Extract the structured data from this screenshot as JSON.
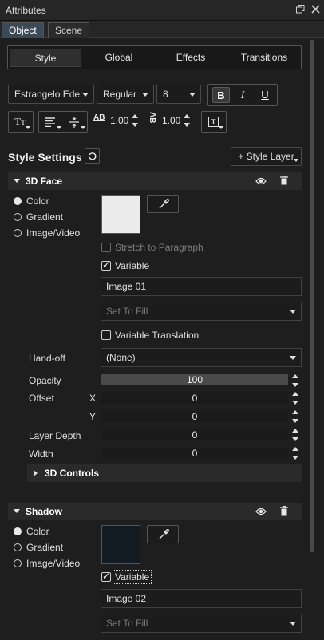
{
  "window": {
    "title": "Attributes",
    "restore_icon": "restore-icon",
    "close_icon": "close-icon"
  },
  "panel_tabs": [
    {
      "label": "Object",
      "active": true
    },
    {
      "label": "Scene",
      "active": false
    }
  ],
  "sub_tabs": [
    {
      "label": "Style",
      "active": true
    },
    {
      "label": "Global"
    },
    {
      "label": "Effects"
    },
    {
      "label": "Transitions"
    }
  ],
  "font": {
    "family": "Estrangelo Ede:",
    "style": "Regular",
    "size": "8",
    "bold": "B",
    "italic": "I",
    "underline": "U"
  },
  "paragraph": {
    "tracking_label": "AB",
    "tracking_value": "1.00",
    "leading_label": "AB",
    "leading_value": "1.00"
  },
  "style_settings": {
    "title": "Style Settings",
    "add_layer_label": "+ Style Layer"
  },
  "face": {
    "title": "3D Face",
    "fill_options": [
      "Color",
      "Gradient",
      "Image/Video"
    ],
    "selected_fill": "Color",
    "swatch_color": "#ececec",
    "stretch_label": "Stretch to Paragraph",
    "variable_label": "Variable",
    "variable_checked": true,
    "image_value": "Image 01",
    "fill_mode": "Set To Fill",
    "variable_translation_label": "Variable Translation",
    "handoff_label": "Hand-off",
    "handoff_value": "(None)",
    "opacity_label": "Opacity",
    "opacity_value": "100",
    "offset_label": "Offset",
    "offset_x_label": "X",
    "offset_x": "0",
    "offset_y_label": "Y",
    "offset_y": "0",
    "layer_depth_label": "Layer Depth",
    "layer_depth": "0",
    "width_label": "Width",
    "width": "0",
    "controls_label": "3D Controls"
  },
  "shadow": {
    "title": "Shadow",
    "fill_options": [
      "Color",
      "Gradient",
      "Image/Video"
    ],
    "selected_fill": "Color",
    "swatch_color": "#121a22",
    "variable_label": "Variable",
    "variable_checked": true,
    "image_value": "Image 02",
    "fill_mode": "Set To Fill"
  }
}
